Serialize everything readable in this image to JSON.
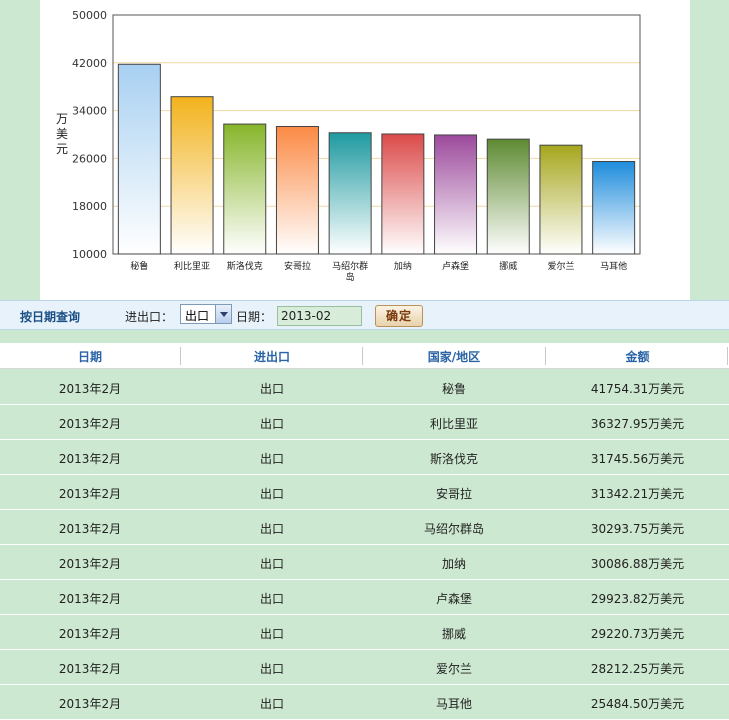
{
  "chart_data": {
    "type": "bar",
    "ylabel": "万美元",
    "ylim": [
      10000,
      50000
    ],
    "yticks": [
      10000,
      18000,
      26000,
      34000,
      42000,
      50000
    ],
    "categories": [
      "秘鲁",
      "利比里亚",
      "斯洛伐克",
      "安哥拉",
      "马绍尔群岛",
      "加纳",
      "卢森堡",
      "挪威",
      "爱尔兰",
      "马耳他"
    ],
    "values": [
      41754.31,
      36327.95,
      31745.56,
      31342.21,
      30293.75,
      30086.88,
      29923.82,
      29220.73,
      28212.25,
      25484.5
    ],
    "colors": [
      "#a8d0f2",
      "#f2b21c",
      "#86b52a",
      "#fb8a45",
      "#1e9aa0",
      "#dc4a4a",
      "#9c4a9c",
      "#5e8a32",
      "#a6a61e",
      "#1e8cdc"
    ],
    "grid": true
  },
  "query": {
    "title": "按日期查询",
    "inout_label": "进出口：",
    "inout_value": "出口",
    "date_label": "日期：",
    "date_value": "2013-02",
    "confirm_label": "确定"
  },
  "table": {
    "headers": [
      "日期",
      "进出口",
      "国家/地区",
      "金额"
    ],
    "rows": [
      [
        "2013年2月",
        "出口",
        "秘鲁",
        "41754.31万美元"
      ],
      [
        "2013年2月",
        "出口",
        "利比里亚",
        "36327.95万美元"
      ],
      [
        "2013年2月",
        "出口",
        "斯洛伐克",
        "31745.56万美元"
      ],
      [
        "2013年2月",
        "出口",
        "安哥拉",
        "31342.21万美元"
      ],
      [
        "2013年2月",
        "出口",
        "马绍尔群岛",
        "30293.75万美元"
      ],
      [
        "2013年2月",
        "出口",
        "加纳",
        "30086.88万美元"
      ],
      [
        "2013年2月",
        "出口",
        "卢森堡",
        "29923.82万美元"
      ],
      [
        "2013年2月",
        "出口",
        "挪威",
        "29220.73万美元"
      ],
      [
        "2013年2月",
        "出口",
        "爱尔兰",
        "28212.25万美元"
      ],
      [
        "2013年2月",
        "出口",
        "马耳他",
        "25484.50万美元"
      ]
    ]
  }
}
